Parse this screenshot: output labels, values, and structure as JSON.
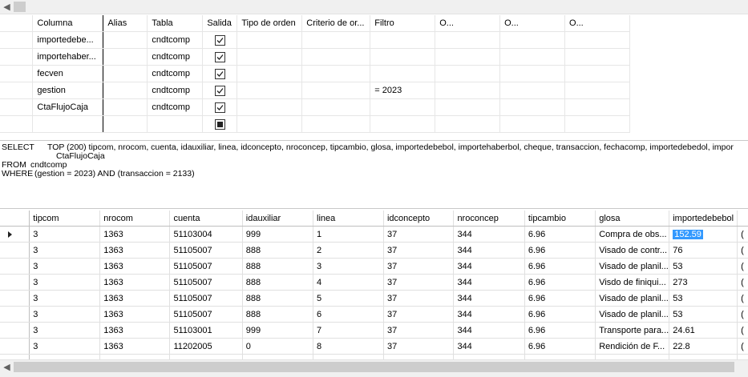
{
  "criteria": {
    "headers": [
      "",
      "Columna",
      "Alias",
      "Tabla",
      "Salida",
      "Tipo de orden",
      "Criterio de or...",
      "Filtro",
      "O...",
      "O...",
      "O..."
    ],
    "rows": [
      {
        "column": "importedebe...",
        "alias": "",
        "table": "cndtcomp",
        "output": true,
        "sort_type": "",
        "sort_order": "",
        "filter": ""
      },
      {
        "column": "importehaber...",
        "alias": "",
        "table": "cndtcomp",
        "output": true,
        "sort_type": "",
        "sort_order": "",
        "filter": ""
      },
      {
        "column": "fecven",
        "alias": "",
        "table": "cndtcomp",
        "output": true,
        "sort_type": "",
        "sort_order": "",
        "filter": ""
      },
      {
        "column": "gestion",
        "alias": "",
        "table": "cndtcomp",
        "output": true,
        "sort_type": "",
        "sort_order": "",
        "filter": "= 2023"
      },
      {
        "column": "CtaFlujoCaja",
        "alias": "",
        "table": "cndtcomp",
        "output": true,
        "sort_type": "",
        "sort_order": "",
        "filter": ""
      },
      {
        "column": "",
        "alias": "",
        "table": "",
        "output": "indeterminate",
        "sort_type": "",
        "sort_order": "",
        "filter": ""
      }
    ]
  },
  "sql": {
    "select_kw": "SELECT",
    "select_text": "TOP (200) tipcom, nrocom, cuenta, idauxiliar, linea, idconcepto, nroconcep, tipcambio, glosa, importedebebol, importehaberbol, cheque, transaccion, fechacomp, importedebedol, impor",
    "select_cont": "CtaFlujoCaja",
    "from_kw": "FROM",
    "from_text": "cndtcomp",
    "where_kw": "WHERE",
    "where_text": "(gestion = 2023) AND (transaccion = 2133)"
  },
  "results": {
    "headers": [
      "tipcom",
      "nrocom",
      "cuenta",
      "idauxiliar",
      "linea",
      "idconcepto",
      "nroconcep",
      "tipcambio",
      "glosa",
      "importedebebol"
    ],
    "rows": [
      [
        "3",
        "1363",
        "51103004",
        "999",
        "1",
        "37",
        "344",
        "6.96",
        "Compra de obs...",
        "152.59"
      ],
      [
        "3",
        "1363",
        "51105007",
        "888",
        "2",
        "37",
        "344",
        "6.96",
        "Visado de contr...",
        "76"
      ],
      [
        "3",
        "1363",
        "51105007",
        "888",
        "3",
        "37",
        "344",
        "6.96",
        "Visado de planil...",
        "53"
      ],
      [
        "3",
        "1363",
        "51105007",
        "888",
        "4",
        "37",
        "344",
        "6.96",
        "Visdo de finiqui...",
        "273"
      ],
      [
        "3",
        "1363",
        "51105007",
        "888",
        "5",
        "37",
        "344",
        "6.96",
        "Visado de planil...",
        "53"
      ],
      [
        "3",
        "1363",
        "51105007",
        "888",
        "6",
        "37",
        "344",
        "6.96",
        "Visado de planil...",
        "53"
      ],
      [
        "3",
        "1363",
        "51103001",
        "999",
        "7",
        "37",
        "344",
        "6.96",
        "Transporte para...",
        "24.61"
      ],
      [
        "3",
        "1363",
        "11202005",
        "0",
        "8",
        "37",
        "344",
        "6.96",
        "Rendición de F...",
        "22.8"
      ]
    ],
    "trailing_cells": [
      "(",
      "(",
      "(",
      "(",
      "(",
      "(",
      "(",
      "("
    ],
    "current_row_icon": "current-row-arrow-icon",
    "selected_value": "152.59"
  },
  "colors": {
    "selection": "#3399ff",
    "scrollbar_bg": "#f0f0f0",
    "scrollbar_thumb": "#cdcdcd"
  }
}
